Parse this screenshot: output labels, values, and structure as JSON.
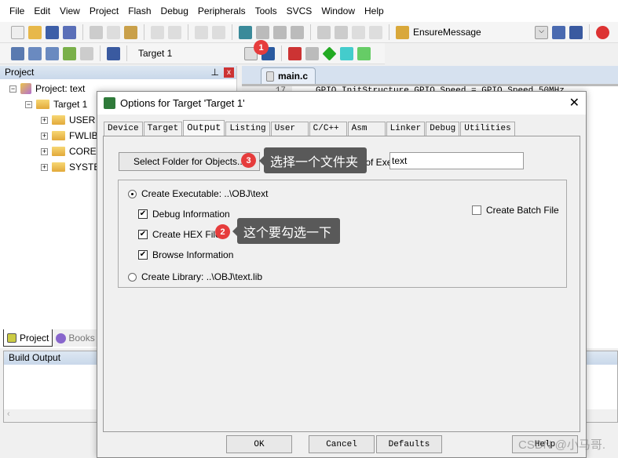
{
  "menu": [
    "File",
    "Edit",
    "View",
    "Project",
    "Flash",
    "Debug",
    "Peripherals",
    "Tools",
    "SVCS",
    "Window",
    "Help"
  ],
  "toolbar": {
    "find_combo": "EnsureMessage",
    "target_select": "Target 1"
  },
  "project_panel": {
    "title": "Project",
    "tree": {
      "root": "Project: text",
      "target": "Target 1",
      "groups": [
        "USER",
        "FWLIB",
        "CORE",
        "SYSTEM"
      ]
    },
    "tabs": [
      "Project",
      "Books"
    ]
  },
  "editor": {
    "tab": "main.c",
    "line_number": "17",
    "code": "GPIO_InitStructure.GPIO_Speed = GPIO_Speed_50MHz"
  },
  "build_output": {
    "title": "Build Output"
  },
  "dialog": {
    "title": "Options for Target 'Target 1'",
    "tabs": [
      "Device",
      "Target",
      "Output",
      "Listing",
      "User",
      "C/C++",
      "Asm",
      "Linker",
      "Debug",
      "Utilities"
    ],
    "active_tab": "Output",
    "select_folder_label": "Select Folder for Objects...",
    "name_label": "Name of Executable:",
    "name_value": "text",
    "create_executable": {
      "label": "Create Executable:  ..\\OBJ\\text",
      "selected": true
    },
    "debug_info": {
      "label": "Debug Information",
      "checked": true
    },
    "create_hex": {
      "label": "Create HEX File",
      "checked": true
    },
    "browse_info": {
      "label": "Browse Information",
      "checked": true
    },
    "create_library": {
      "label": "Create Library:  ..\\OBJ\\text.lib",
      "selected": false
    },
    "create_batch": {
      "label": "Create Batch File",
      "checked": false
    },
    "buttons": {
      "ok": "OK",
      "cancel": "Cancel",
      "defaults": "Defaults",
      "help": "Help"
    }
  },
  "annotations": {
    "badge1": "1",
    "badge2": "2",
    "badge3": "3",
    "tip2": "这个要勾选一下",
    "tip3": "选择一个文件夹"
  },
  "watermark": "CSDN @小马哥."
}
